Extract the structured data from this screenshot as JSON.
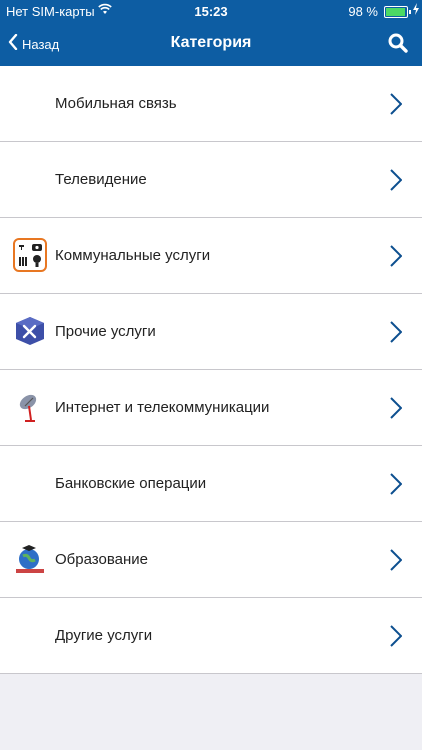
{
  "status_bar": {
    "carrier": "Нет SIM-карты",
    "time": "15:23",
    "battery_percent": "98 %"
  },
  "navbar": {
    "back_label": "Назад",
    "title": "Категория"
  },
  "categories": [
    {
      "label": "Мобильная связь",
      "icon": "none"
    },
    {
      "label": "Телевидение",
      "icon": "none"
    },
    {
      "label": "Коммунальные услуги",
      "icon": "utilities-icon"
    },
    {
      "label": "Прочие услуги",
      "icon": "tools-box-icon"
    },
    {
      "label": "Интернет и телекоммуникации",
      "icon": "satellite-dish-icon"
    },
    {
      "label": "Банковские операции",
      "icon": "none"
    },
    {
      "label": "Образование",
      "icon": "education-globe-icon"
    },
    {
      "label": "Другие услуги",
      "icon": "none"
    }
  ],
  "colors": {
    "header": "#0d5da3",
    "chevron": "#0d4f8f",
    "background": "#efeff4"
  }
}
